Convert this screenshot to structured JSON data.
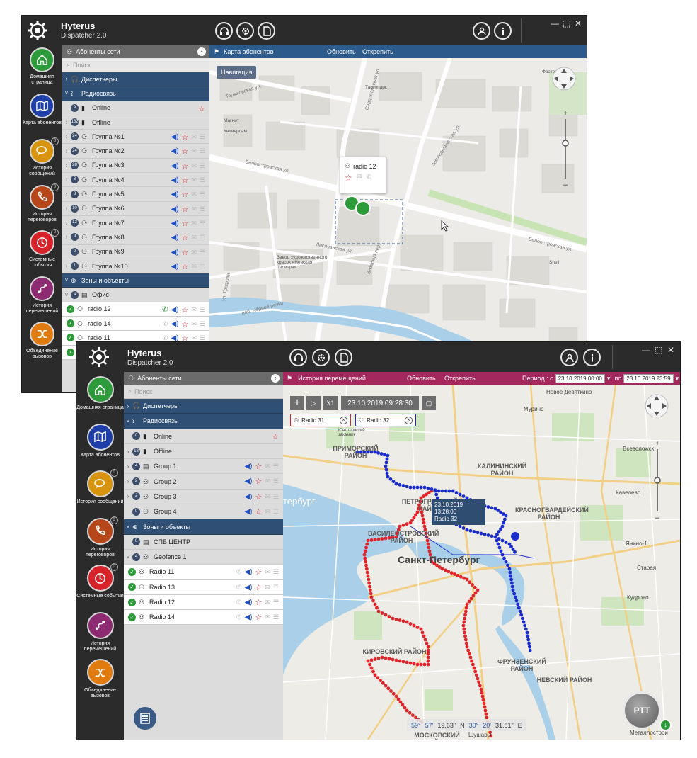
{
  "colors": {
    "accent_blue": "#2f4f74",
    "map_bar_blue": "#2c5a8b",
    "history_bar": "#a3285e",
    "track_red": "#e0242a",
    "track_blue": "#1b2ccc"
  },
  "win1": {
    "brand": "Hyterus",
    "sub": "Dispatcher 2.0",
    "nav": [
      {
        "icon": "home-icon",
        "label": "Домашняя страница",
        "color": "#2e9b3a"
      },
      {
        "icon": "map-icon",
        "label": "Карта абонентов",
        "color": "#1f3fa8"
      },
      {
        "icon": "messages-icon",
        "label": "История сообщений",
        "color": "#d8940e",
        "badge": "0"
      },
      {
        "icon": "phone-icon",
        "label": "История переговоров",
        "color": "#b5471b",
        "badge": "0"
      },
      {
        "icon": "alarm-icon",
        "label": "Системные события",
        "color": "#d8222a",
        "badge": "0"
      },
      {
        "icon": "route-icon",
        "label": "История перемещений",
        "color": "#8e2a72"
      },
      {
        "icon": "merge-icon",
        "label": "Объединение вызовов",
        "color": "#e07b10"
      }
    ],
    "panel_title": "Абоненты сети",
    "search_placeholder": "Поиск",
    "rows": [
      {
        "type": "sec",
        "chev": "›",
        "icon": "headset",
        "label": "Диспетчеры"
      },
      {
        "type": "sec",
        "chev": "˅",
        "icon": "radio",
        "label": "Радиосвязь"
      },
      {
        "type": "item",
        "num": "9",
        "icon": "signal",
        "label": "Online",
        "star": true,
        "sub": true
      },
      {
        "type": "item",
        "chev": "›",
        "num": "182",
        "icon": "signal",
        "label": "Offline"
      },
      {
        "type": "item",
        "chev": "›",
        "num": "24",
        "icon": "group",
        "label": "Группа №1",
        "acts": true
      },
      {
        "type": "item",
        "chev": "›",
        "num": "24",
        "icon": "group",
        "label": "Группа №2",
        "acts": true
      },
      {
        "type": "item",
        "chev": "›",
        "num": "28",
        "icon": "group",
        "label": "Группа №3",
        "acts": true
      },
      {
        "type": "item",
        "chev": "›",
        "num": "8",
        "icon": "group",
        "label": "Группа №4",
        "acts": true
      },
      {
        "type": "item",
        "chev": "›",
        "num": "8",
        "icon": "group",
        "label": "Группа №5",
        "acts": true
      },
      {
        "type": "item",
        "chev": "›",
        "num": "10",
        "icon": "group",
        "label": "Группа №6",
        "acts": true
      },
      {
        "type": "item",
        "chev": "›",
        "num": "12",
        "icon": "group",
        "label": "Группа №7",
        "acts": true
      },
      {
        "type": "item",
        "chev": "›",
        "num": "9",
        "icon": "group",
        "label": "Группа №8",
        "acts": true
      },
      {
        "type": "item",
        "num": "0",
        "icon": "group",
        "label": "Группа №9",
        "acts": true,
        "sub": true
      },
      {
        "type": "item",
        "chev": "›",
        "num": "1",
        "icon": "group",
        "label": "Группа №10",
        "acts": true
      },
      {
        "type": "sec",
        "chev": "˅",
        "icon": "globe",
        "label": "Зоны и объекты"
      },
      {
        "type": "item",
        "chev": "˅",
        "num": "4",
        "icon": "building",
        "label": "Офис"
      },
      {
        "type": "user",
        "label": "radio 12",
        "acts": true,
        "phone": true
      },
      {
        "type": "user",
        "label": "radio 14",
        "acts": true
      },
      {
        "type": "user",
        "label": "radio 11",
        "acts": true
      },
      {
        "type": "user",
        "label": "",
        "acts": false
      }
    ],
    "map_title": "Карта абонентов",
    "refresh": "Обновить",
    "detach": "Открепить",
    "navigation_btn": "Навигация",
    "popup_label": "radio 12",
    "street_labels": [
      {
        "text": "Торжковская ул.",
        "cls": "street"
      },
      {
        "text": "Сердобольская ул.",
        "cls": "street"
      },
      {
        "text": "Белоостровская ул.",
        "cls": "street"
      },
      {
        "text": "Земледельческая ул.",
        "cls": "street"
      },
      {
        "text": "Лисичанская ул.",
        "cls": "street"
      },
      {
        "text": "Вазаский пер.",
        "cls": "street"
      },
      {
        "text": "наб. Чёрной речки",
        "cls": "street"
      },
      {
        "text": "ул. Графова",
        "cls": "street"
      },
      {
        "text": "Белоостровская ул.",
        "cls": "street"
      },
      {
        "text": "Магнит",
        "cls": "poi"
      },
      {
        "text": "Универсам",
        "cls": "poi"
      },
      {
        "text": "Таксопарк",
        "cls": "poi"
      },
      {
        "text": "Фаэтон",
        "cls": "poi"
      },
      {
        "text": "Shell",
        "cls": "poi"
      },
      {
        "text": "Завод художественного красок «Невская палитра»",
        "cls": "poi"
      }
    ]
  },
  "win2": {
    "brand": "Hyterus",
    "sub": "Dispatcher 2.0",
    "nav": [
      {
        "icon": "home-icon",
        "label": "Домашняя страница",
        "color": "#2e9b3a"
      },
      {
        "icon": "map-icon",
        "label": "Карта абонентов",
        "color": "#1f3fa8"
      },
      {
        "icon": "messages-icon",
        "label": "История сообщений",
        "color": "#d8940e",
        "badge": "0"
      },
      {
        "icon": "phone-icon",
        "label": "История переговоров",
        "color": "#b5471b",
        "badge": "0"
      },
      {
        "icon": "alarm-icon",
        "label": "Системные события",
        "color": "#d8222a",
        "badge": "0"
      },
      {
        "icon": "route-icon",
        "label": "История перемещений",
        "color": "#8e2a72"
      },
      {
        "icon": "merge-icon",
        "label": "Объединение вызовов",
        "color": "#e07b10"
      }
    ],
    "panel_title": "Абоненты сети",
    "search_placeholder": "Поиск",
    "rows": [
      {
        "type": "sec",
        "chev": "›",
        "icon": "headset",
        "label": "Диспетчеры"
      },
      {
        "type": "sec",
        "chev": "˅",
        "icon": "radio",
        "label": "Радиосвязь"
      },
      {
        "type": "item",
        "num": "0",
        "icon": "signal",
        "label": "Online",
        "star": true,
        "sub": true
      },
      {
        "type": "item",
        "chev": "›",
        "num": "18",
        "icon": "signal",
        "label": "Offline"
      },
      {
        "type": "item",
        "chev": "›",
        "num": "4",
        "icon": "building",
        "label": "Group 1",
        "acts": true
      },
      {
        "type": "item",
        "chev": "›",
        "num": "2",
        "icon": "group",
        "label": "Group 2",
        "acts": true
      },
      {
        "type": "item",
        "chev": "›",
        "num": "2",
        "icon": "group",
        "label": "Group 3",
        "acts": true
      },
      {
        "type": "item",
        "num": "0",
        "icon": "group",
        "label": "Group 4",
        "acts": true,
        "sub": true
      },
      {
        "type": "sec",
        "chev": "˅",
        "icon": "globe",
        "label": "Зоны и объекты"
      },
      {
        "type": "item",
        "num": "0",
        "icon": "building",
        "label": "СПБ ЦЕНТР",
        "sub": true
      },
      {
        "type": "item",
        "chev": "˅",
        "num": "4",
        "icon": "group",
        "label": "Geofence 1"
      },
      {
        "type": "user",
        "label": "Radio 11",
        "acts": true
      },
      {
        "type": "user",
        "label": "Radio 13",
        "acts": true
      },
      {
        "type": "user",
        "label": "Radio 12",
        "acts": true
      },
      {
        "type": "user",
        "label": "Radio 14",
        "acts": true
      }
    ],
    "map_title": "История перемещений",
    "refresh": "Обновить",
    "detach": "Открепить",
    "period_label": "Период : с",
    "period_from": "23.10.2019 00:00",
    "period_to_label": "по",
    "period_to": "23.10.2019 23:59",
    "speed": "X1",
    "current_time": "23.10.2019 09:28:30",
    "chips": [
      "Radio 31",
      "Radio 32"
    ],
    "tooltip_time": "23.10.2019 13:28:00",
    "tooltip_name": "Radio 32",
    "coords": {
      "lat_deg": "59°",
      "lat_min": "57'",
      "lat_sec": "19,63\"",
      "lat_hemi": "N",
      "lon_deg": "30°",
      "lon_min": "20'",
      "lon_sec": "31.81\"",
      "lon_hemi": "E"
    },
    "ptt": "PTT",
    "districts": [
      "ПРИМОРСКИЙ РАЙОН",
      "КАЛИНИНСКИЙ РАЙОН",
      "ПЕТРОГРАДСКИЙ РАЙОН",
      "КРАСНОГВАРДЕЙСКИЙ РАЙОН",
      "ВАСИЛЕОСТРОВСКИЙ РАЙОН",
      "Санкт-Петербург",
      "КИРОВСКИЙ РАЙОН",
      "ФРУНЗЕНСКИЙ РАЙОН",
      "НЕВСКИЙ РАЙОН",
      "МОСКОВСКИЙ РАЙОН",
      "тербург"
    ],
    "places": [
      "Новое Девяткино",
      "Мурино",
      "Всеволожск",
      "Кудрово",
      "Янино-1",
      "Старая",
      "Кавелево",
      "Металлострой",
      "Шушары",
      "Юнтоловский заказник"
    ]
  }
}
